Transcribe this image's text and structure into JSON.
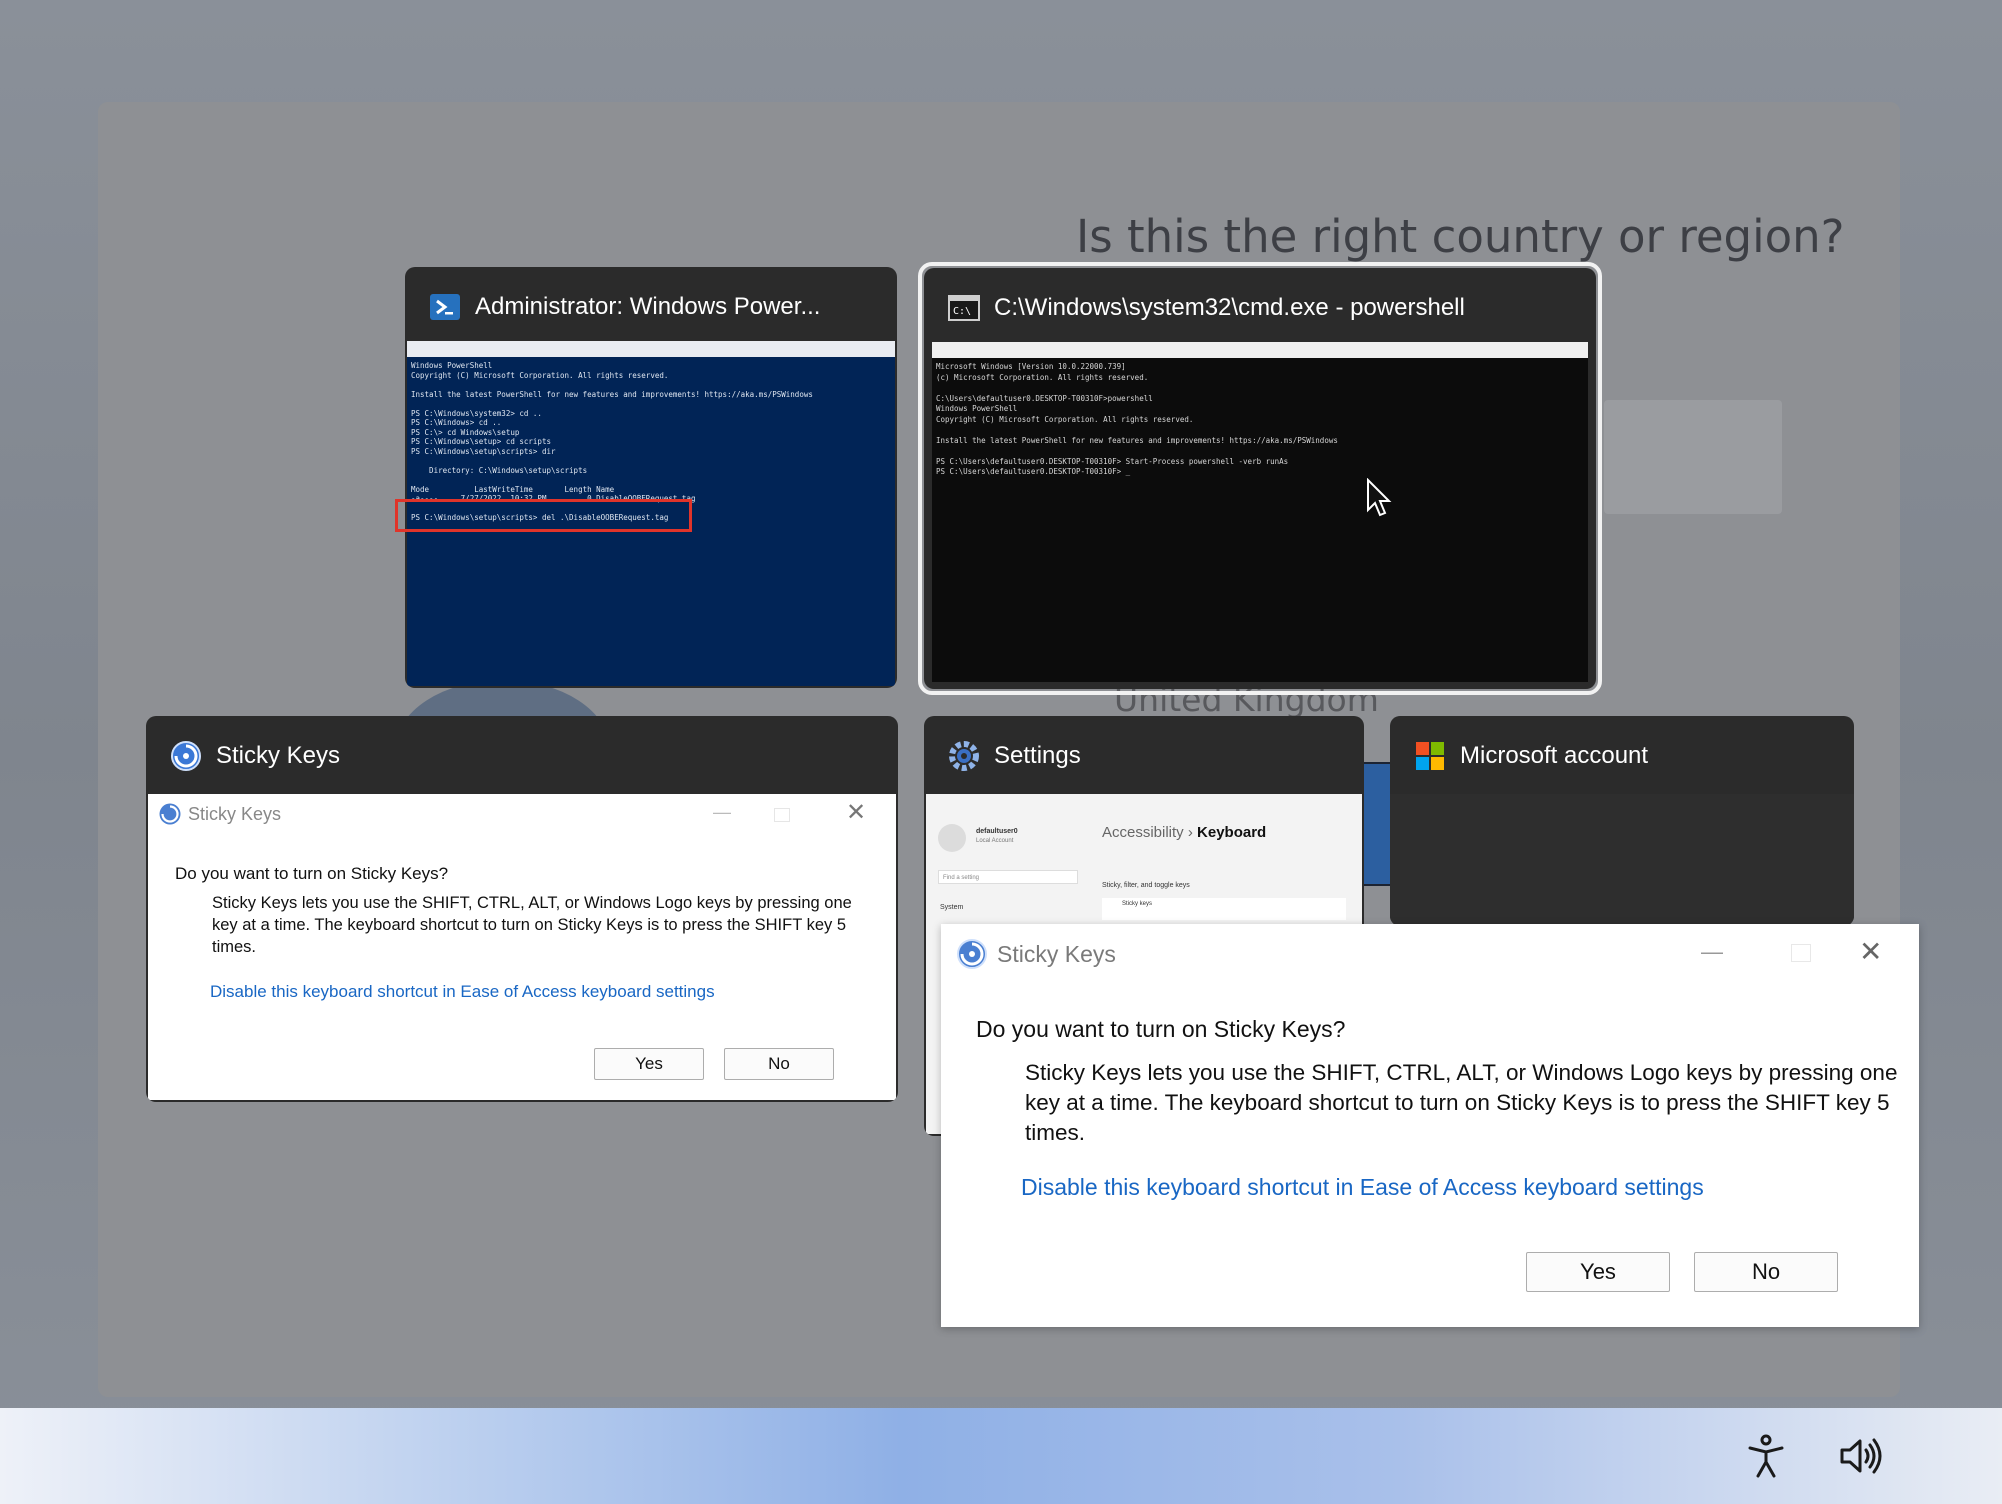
{
  "oobe": {
    "question": "Is this the right country or region?",
    "country": "United Kingdom"
  },
  "switcher": {
    "powershell_admin": {
      "title": "Administrator: Windows Power...",
      "thumb_lines": [
        "Windows PowerShell",
        "Copyright (C) Microsoft Corporation. All rights reserved.",
        "",
        "Install the latest PowerShell for new features and improvements! https://aka.ms/PSWindows",
        "",
        "PS C:\\Windows\\system32> cd ..",
        "PS C:\\Windows> cd ..",
        "PS C:\\> cd Windows\\setup",
        "PS C:\\Windows\\setup> cd scripts",
        "PS C:\\Windows\\setup\\scripts> dir",
        "",
        "    Directory: C:\\Windows\\setup\\scripts",
        "",
        "Mode          LastWriteTime       Length Name",
        "-a----     7/27/2022  10:32 PM         0 DisableOOBERequest.tag",
        "",
        "PS C:\\Windows\\setup\\scripts> del .\\DisableOOBERequest.tag"
      ]
    },
    "cmd": {
      "title": "C:\\Windows\\system32\\cmd.exe - powershell",
      "thumb_lines": [
        "Microsoft Windows [Version 10.0.22000.739]",
        "(c) Microsoft Corporation. All rights reserved.",
        "",
        "C:\\Users\\defaultuser0.DESKTOP-T00310F>powershell",
        "Windows PowerShell",
        "Copyright (C) Microsoft Corporation. All rights reserved.",
        "",
        "Install the latest PowerShell for new features and improvements! https://aka.ms/PSWindows",
        "",
        "PS C:\\Users\\defaultuser0.DESKTOP-T00310F> Start-Process powershell -verb runAs",
        "PS C:\\Users\\defaultuser0.DESKTOP-T00310F> _"
      ]
    },
    "sticky_small": {
      "title": "Sticky Keys"
    },
    "settings": {
      "title": "Settings",
      "breadcrumb_parent": "Accessibility",
      "breadcrumb_sep": "›",
      "breadcrumb_current": "Keyboard",
      "user_name": "defaultuser0",
      "user_sub": "Local Account",
      "search_placeholder": "Find a setting",
      "nav_system": "System",
      "section": "Sticky, filter, and toggle keys",
      "row": "Sticky keys"
    },
    "msaccount": {
      "title": "Microsoft account"
    }
  },
  "sticky_dialog": {
    "caption": "Sticky Keys",
    "question": "Do you want to turn on Sticky Keys?",
    "body": "Sticky Keys lets you use the SHIFT, CTRL, ALT, or Windows Logo keys by pressing one key at a time. The keyboard shortcut to turn on Sticky Keys is to press the SHIFT key 5 times.",
    "link": "Disable this keyboard shortcut in Ease of Access keyboard settings",
    "yes": "Yes",
    "no": "No"
  },
  "colors": {
    "powershell_bg": "#012456",
    "cmd_bg": "#0c0c0c",
    "card_bg": "#2b2b2b",
    "highlight": "#e0342a",
    "link": "#1967c4"
  }
}
